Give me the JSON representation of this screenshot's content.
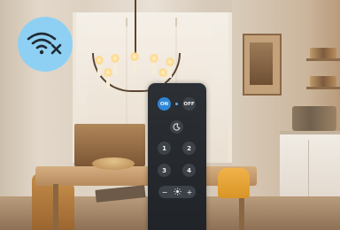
{
  "status": {
    "wifi_icon": "wifi-off-icon",
    "badge_color": "#8ed0f3"
  },
  "remote": {
    "on_label": "ON",
    "off_label": "OFF",
    "night_icon": "moon-icon",
    "numbers": [
      "1",
      "2",
      "3",
      "4"
    ],
    "dim_minus": "−",
    "dim_icon": "brightness-icon",
    "dim_plus": "+",
    "on_color": "#2f86d6"
  }
}
